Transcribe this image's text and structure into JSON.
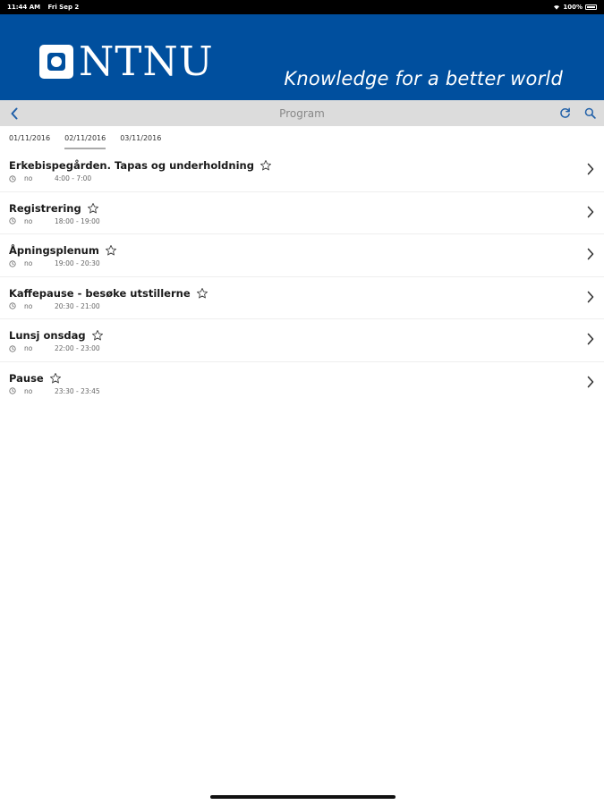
{
  "status": {
    "time": "11:44 AM",
    "date": "Fri Sep 2",
    "battery": "100%"
  },
  "banner": {
    "logo_text": "NTNU",
    "tagline": "Knowledge for a better world",
    "color": "#004f9e"
  },
  "nav": {
    "title": "Program"
  },
  "date_tabs": [
    {
      "label": "01/11/2016",
      "active": false
    },
    {
      "label": "02/11/2016",
      "active": true
    },
    {
      "label": "03/11/2016",
      "active": false
    }
  ],
  "items": [
    {
      "title": "Erkebispegården. Tapas og underholdning",
      "location": "no",
      "time": "4:00 - 7:00"
    },
    {
      "title": "Registrering",
      "location": "no",
      "time": "18:00 - 19:00"
    },
    {
      "title": "Åpningsplenum",
      "location": "no",
      "time": "19:00 - 20:30"
    },
    {
      "title": "Kaffepause - besøke utstillerne",
      "location": "no",
      "time": "20:30 - 21:00"
    },
    {
      "title": "Lunsj onsdag",
      "location": "no",
      "time": "22:00 - 23:00"
    },
    {
      "title": "Pause",
      "location": "no",
      "time": "23:30 - 23:45"
    }
  ]
}
